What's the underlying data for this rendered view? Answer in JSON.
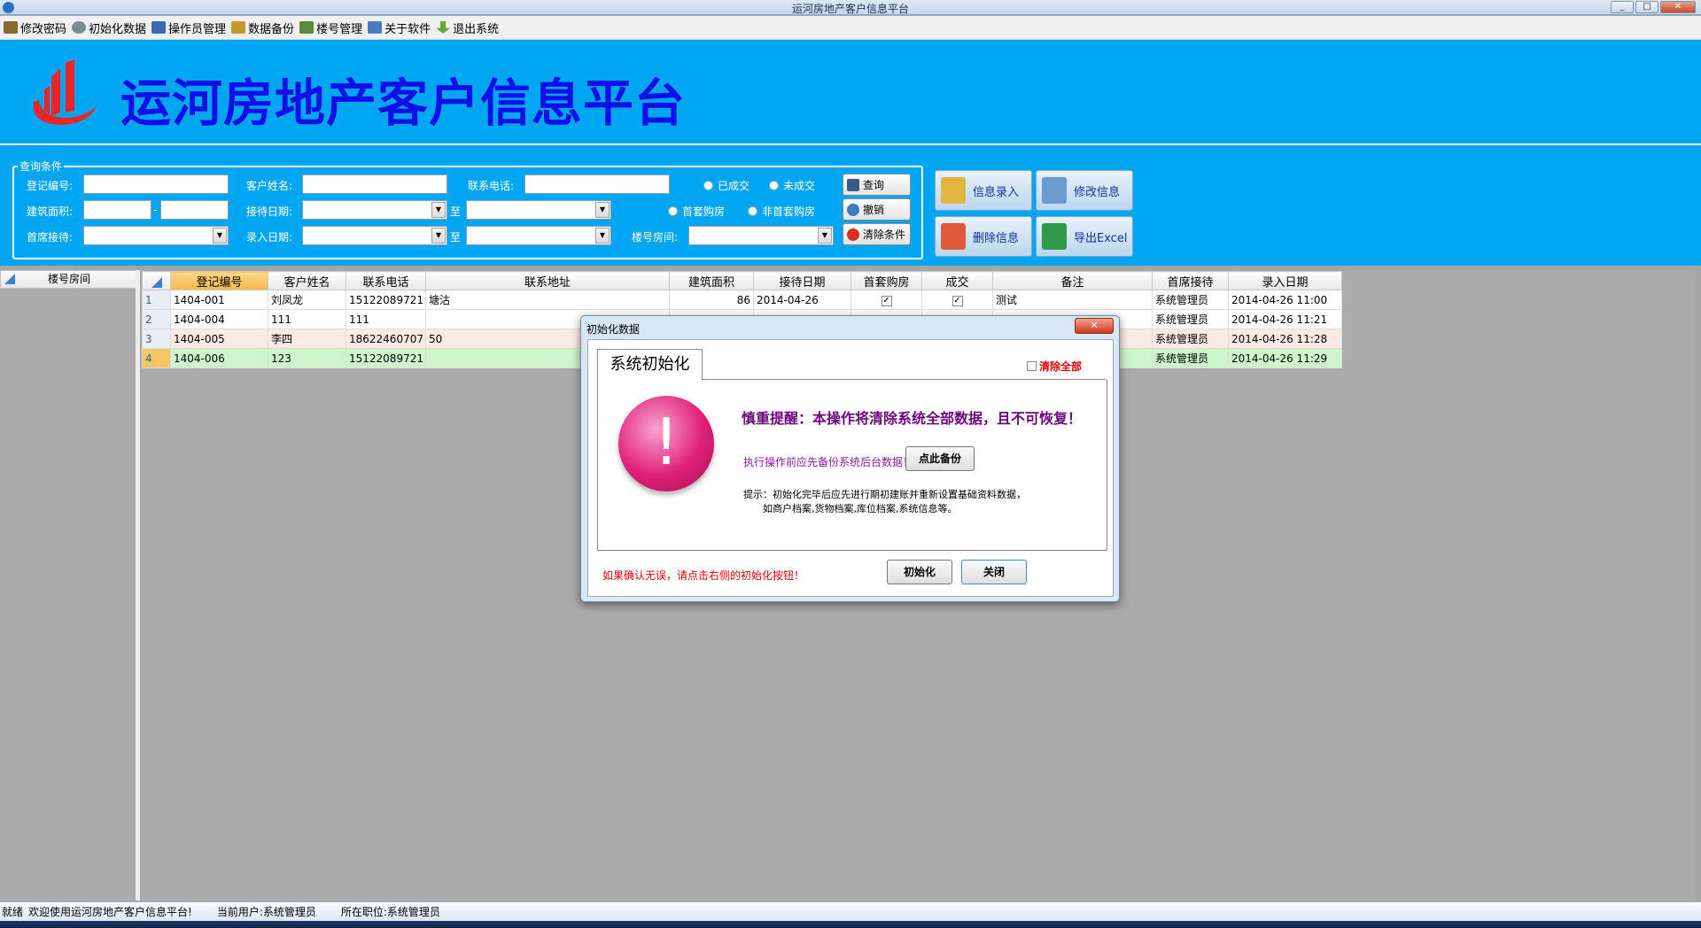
{
  "window": {
    "title": "运河房地产客户信息平台",
    "controls": [
      "_",
      "□",
      "✕"
    ]
  },
  "menu": [
    {
      "label": "修改密码",
      "icon": "key-icon",
      "color": "#8a6a2a"
    },
    {
      "label": "初始化数据",
      "icon": "gear-icon",
      "color": "#7f8c8d"
    },
    {
      "label": "操作员管理",
      "icon": "users-icon",
      "color": "#3a6bb0"
    },
    {
      "label": "数据备份",
      "icon": "backup-icon",
      "color": "#c29a2c"
    },
    {
      "label": "楼号管理",
      "icon": "building-icon",
      "color": "#5a8a3a"
    },
    {
      "label": "关于软件",
      "icon": "info-icon",
      "color": "#4a7ac0"
    },
    {
      "label": "退出系统",
      "icon": "exit-arrow-icon",
      "color": "#6aa83a"
    }
  ],
  "banner": {
    "title": "运河房地产客户信息平台",
    "bg": "#00a6f2",
    "title_color": "#1010e6"
  },
  "query": {
    "legend": "查询条件",
    "labels": {
      "reg_no": "登记编号:",
      "customer": "客户姓名:",
      "phone": "联系电话:",
      "area": "建筑面积:",
      "area_sep": "-",
      "reception_date": "接待日期:",
      "to1": "至",
      "first_reception": "首席接待:",
      "entry_date": "录入日期:",
      "to2": "至",
      "room": "楼号房间:"
    },
    "radios": {
      "done": "已成交",
      "not_done": "未成交",
      "first_home": "首套购房",
      "not_first": "非首套购房"
    },
    "buttons": {
      "search": "查询",
      "undo": "撤销",
      "clear": "清除条件"
    }
  },
  "actions": {
    "add": "信息录入",
    "edit": "修改信息",
    "delete": "删除信息",
    "export": "导出Excel"
  },
  "left_panel": {
    "header": "楼号房间"
  },
  "grid": {
    "columns": [
      "登记编号",
      "客户姓名",
      "联系电话",
      "联系地址",
      "建筑面积",
      "接待日期",
      "首套购房",
      "成交",
      "备注",
      "首席接待",
      "录入日期"
    ],
    "rows": [
      {
        "n": "1",
        "reg": "1404-001",
        "name": "刘凤龙",
        "phone": "15122089721",
        "addr": "塘沽",
        "area": "86",
        "date": "2014-04-26",
        "first": true,
        "deal": true,
        "note": "测试",
        "agent": "系统管理员",
        "entry": "2014-04-26 11:00"
      },
      {
        "n": "2",
        "reg": "1404-004",
        "name": "111",
        "phone": "111",
        "addr": "",
        "area": "",
        "date": "",
        "first": false,
        "deal": false,
        "note": "",
        "agent": "系统管理员",
        "entry": "2014-04-26 11:21"
      },
      {
        "n": "3",
        "reg": "1404-005",
        "name": "李四",
        "phone": "18622460707",
        "addr": "50",
        "area": "",
        "date": "",
        "first": false,
        "deal": false,
        "note": "",
        "agent": "系统管理员",
        "entry": "2014-04-26 11:28"
      },
      {
        "n": "4",
        "reg": "1404-006",
        "name": "123",
        "phone": "15122089721",
        "addr": "",
        "area": "",
        "date": "",
        "first": false,
        "deal": false,
        "note": "",
        "agent": "系统管理员",
        "entry": "2014-04-26 11:29"
      }
    ]
  },
  "dialog": {
    "title": "初始化数据",
    "tab": "系统初始化",
    "clear_all": "清除全部",
    "warning": "慎重提醒：本操作将清除系统全部数据，且不可恢复！",
    "backup_prompt": "执行操作前应先备份系统后台数据！",
    "backup_button": "点此备份",
    "hint_line1": "提示：初始化完毕后应先进行期初建账并重新设置基础资料数据，",
    "hint_line2": "如商户档案,货物档案,库位档案,系统信息等。",
    "confirm": "如果确认无误，请点击右侧的初始化按钮！",
    "init_button": "初始化",
    "close_button": "关闭",
    "close_x": "✕"
  },
  "status": {
    "ready": "就绪",
    "welcome": "欢迎使用运河房地产客户信息平台!",
    "user": "当前用户:系统管理员",
    "position": "所在职位:系统管理员"
  }
}
